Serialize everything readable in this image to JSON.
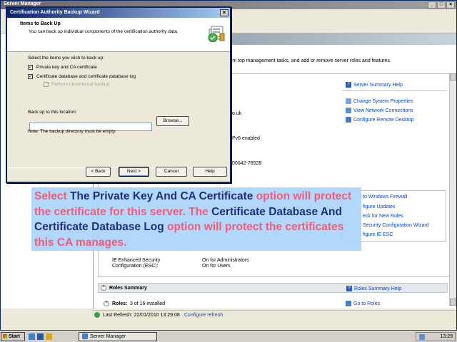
{
  "server_manager": {
    "title": "Server Manager",
    "description": "rm top management tasks, and add or remove server roles and features.",
    "panel_links": {
      "server_summary_help": "Server Summary Help",
      "change_system_properties": "Change System Properties",
      "view_network_connections": "View Network Connections",
      "configure_remote_desktop": "Configure Remote Desktop",
      "go_to_windows_firewall": "to Windows Firewall",
      "configure_updates": "figure Updates",
      "check_for_new_roles": "eck for New Roles",
      "run_security_config_wizard": "Security Configuration Wizard",
      "configure_ie_esc": "figure IE ESC"
    },
    "partial_values": {
      "domain_suffix": "o.uk",
      "ipv6": "Pv6 enabled",
      "product_id": "00042-76528"
    },
    "ie_esc": {
      "label": "IE Enhanced Security Configuration (ESC):",
      "admins": "On for Administrators",
      "users": "On for Users"
    },
    "roles_summary": {
      "title": "Roles Summary",
      "help": "Roles Summary Help",
      "roles_label": "Roles:",
      "roles_count": "3 of 16 installed",
      "go_to_roles": "Go to Roles"
    },
    "status": {
      "last_refresh": "Last Refresh: 22/01/2010 13:29:08",
      "configure_refresh": "Configure refresh"
    }
  },
  "wizard": {
    "title": "Certification Authority Backup Wizard",
    "heading": "Items to Back Up",
    "subheading": "You can back up individual components of the certification authority data.",
    "select_label": "Select the items you wish to back up:",
    "options": [
      {
        "label": "Private key and CA certificate",
        "checked": true,
        "enabled": true
      },
      {
        "label": "Certificate database and certificate database log",
        "checked": true,
        "enabled": true
      },
      {
        "label": "Perform incremental backup",
        "checked": false,
        "enabled": false
      }
    ],
    "location_label": "Back up to this location:",
    "location_value": "",
    "browse_label": "Browse...",
    "note": "Note: The backup directory must be empty.",
    "buttons": {
      "back": "< Back",
      "next": "Next >",
      "cancel": "Cancel",
      "help": "Help"
    }
  },
  "caption": {
    "part1": "Select ",
    "part2": "The Private Key And CA Certificate",
    "part3": " option will protect the certificate for this server. The ",
    "part4": "Certificate Database And Certificate Database Log",
    "part5": " option will protect the certificates this CA manages."
  },
  "taskbar": {
    "start": "Start",
    "task": "Server Manager",
    "clock": "13:29"
  },
  "colors": {
    "caption_pink": "#f25c77",
    "caption_navy": "#1f2e7e",
    "caption_bg": "#aad4fa",
    "link_blue": "#0046d5"
  }
}
